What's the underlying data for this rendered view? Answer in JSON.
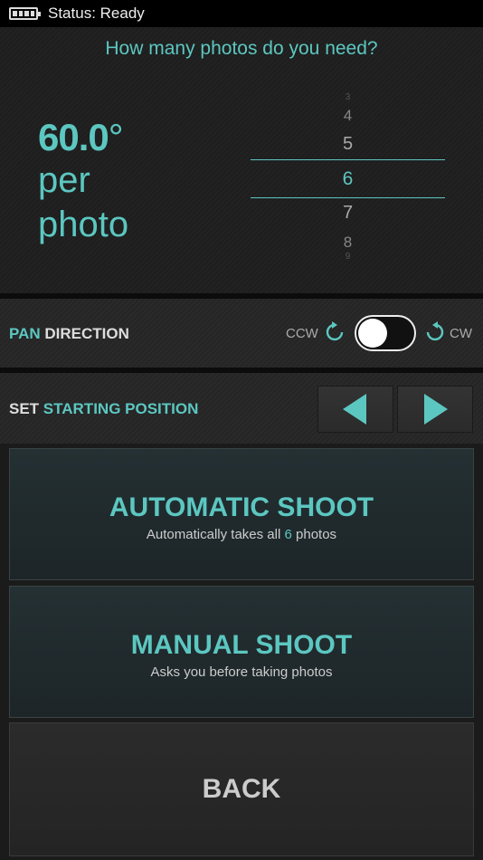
{
  "status_bar": {
    "text": "Status: Ready",
    "battery_icon": "battery-full-icon"
  },
  "photo_panel": {
    "question": "How many photos do you need?",
    "angle_value": "60.0",
    "angle_symbol": "°",
    "per_label": "per",
    "photo_label": "photo",
    "picker": {
      "values": [
        "3",
        "4",
        "5",
        "6",
        "7",
        "8",
        "9"
      ],
      "selected": "6"
    }
  },
  "pan_direction": {
    "label_accent": "PAN",
    "label_plain": "DIRECTION",
    "ccw_label": "CCW",
    "cw_label": "CW",
    "toggle_state": "ccw"
  },
  "starting_position": {
    "label_plain": "SET",
    "label_accent": "STARTING POSITION",
    "left_icon": "triangle-left-icon",
    "right_icon": "triangle-right-icon"
  },
  "automatic_shoot": {
    "title": "AUTOMATIC SHOOT",
    "sub_before": "Automatically takes all",
    "sub_count": "6",
    "sub_after": "photos"
  },
  "manual_shoot": {
    "title": "MANUAL SHOOT",
    "sub": "Asks you before taking photos"
  },
  "back": {
    "title": "BACK"
  },
  "colors": {
    "accent": "#5cc7c1",
    "background": "#1b1b1b"
  }
}
